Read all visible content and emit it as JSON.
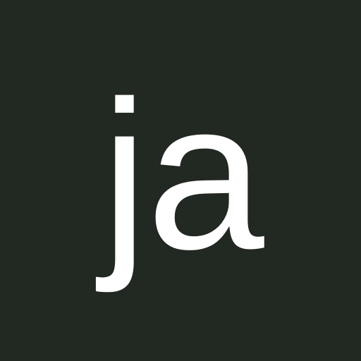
{
  "logo": {
    "text": "ja",
    "background_color": "#222822",
    "text_color": "#ffffff"
  }
}
